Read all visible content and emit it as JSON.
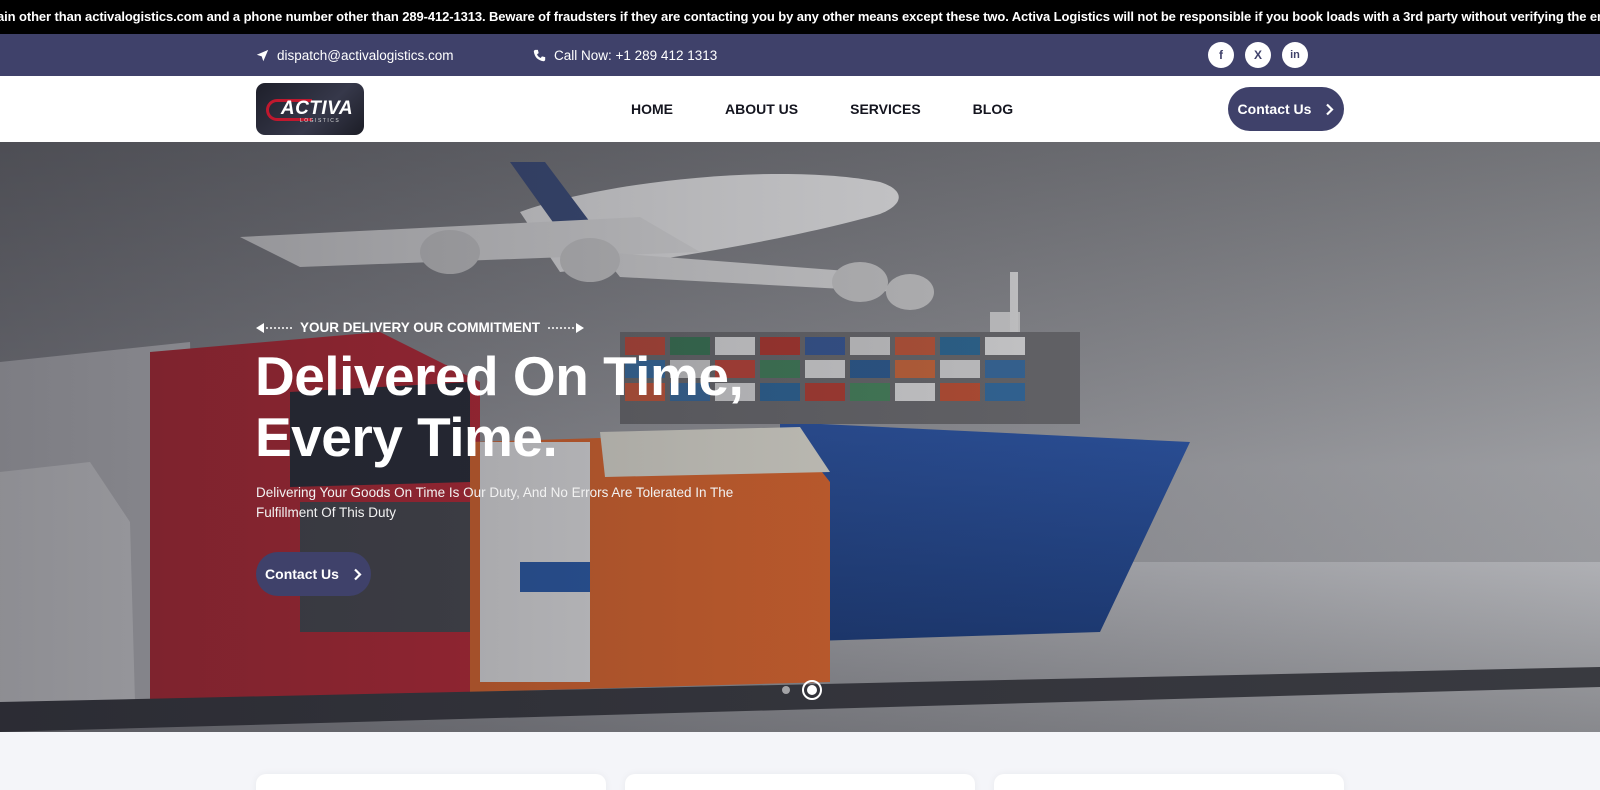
{
  "ticker": {
    "text": "ain other than activalogistics.com and a phone number other than 289-412-1313. Beware of fraudsters if they are contacting you by any other means except these two. Activa Logistics will not be responsible if you book loads with a 3rd party without verifying the email domain and Phone number"
  },
  "topbar": {
    "email": "dispatch@activalogistics.com",
    "phone": "Call Now: +1 289 412 1313",
    "socials": [
      {
        "name": "facebook-icon",
        "glyph": "f"
      },
      {
        "name": "x-icon",
        "glyph": "X"
      },
      {
        "name": "linkedin-icon",
        "glyph": "in"
      }
    ]
  },
  "nav": {
    "logo_text": "ACTIVA",
    "logo_subtext": "LOGISTICS",
    "menu": [
      "HOME",
      "ABOUT US",
      "SERVICES",
      "BLOG"
    ],
    "cta": "Contact Us"
  },
  "hero": {
    "eyebrow": "YOUR DELIVERY OUR COMMITMENT",
    "title_line1": "Delivered On Time,",
    "title_line2": "Every Time.",
    "description": "Delivering Your Goods On Time Is Our Duty, And No Errors Are Tolerated In The Fulfillment Of This Duty",
    "cta": "Contact Us",
    "slide_count": 2,
    "active_slide": 2
  },
  "colors": {
    "brand": "#3f416a",
    "ticker_bg": "#000000",
    "text_light": "#ffffff"
  }
}
